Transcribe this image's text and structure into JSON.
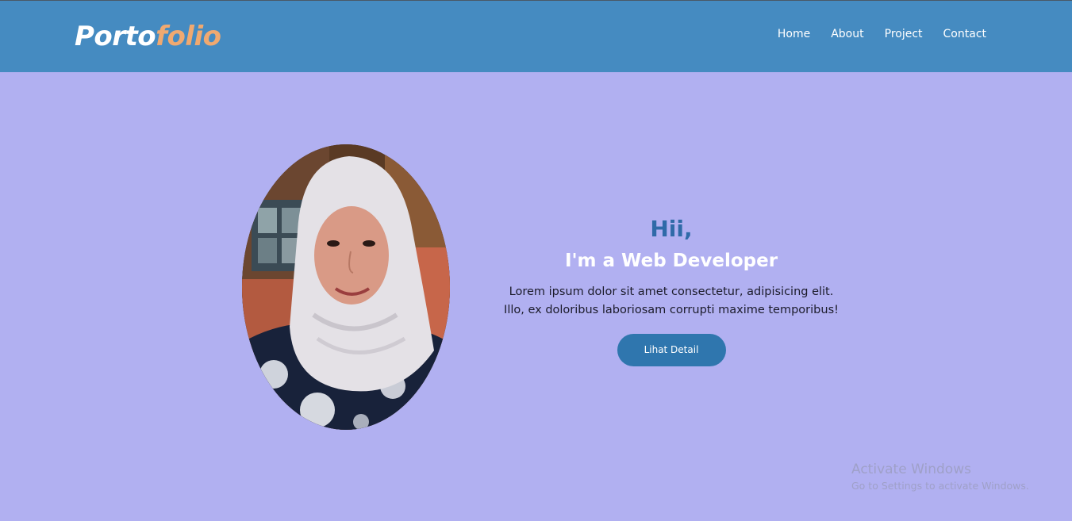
{
  "navbar": {
    "logo_part1": "Porto",
    "logo_part2": "folio",
    "links": [
      {
        "label": "Home"
      },
      {
        "label": "About"
      },
      {
        "label": "Project"
      },
      {
        "label": "Contact"
      }
    ]
  },
  "hero": {
    "greeting": "Hii,",
    "role": "I'm a Web Developer",
    "description_line1": "Lorem ipsum dolor sit amet consectetur, adipisicing elit.",
    "description_line2": "Illo, ex doloribus laboriosam corrupti maxime temporibus!",
    "button_label": "Lihat Detail"
  },
  "watermark": {
    "title": "Activate Windows",
    "subtitle": "Go to Settings to activate Windows."
  },
  "colors": {
    "navbar_bg": "#458bc1",
    "page_bg": "#b1b0f1",
    "logo_accent": "#f0a970",
    "greeting": "#2f6aa8",
    "button_bg": "#2f76ae"
  },
  "icons": {
    "profile_photo": "profile-photo"
  }
}
